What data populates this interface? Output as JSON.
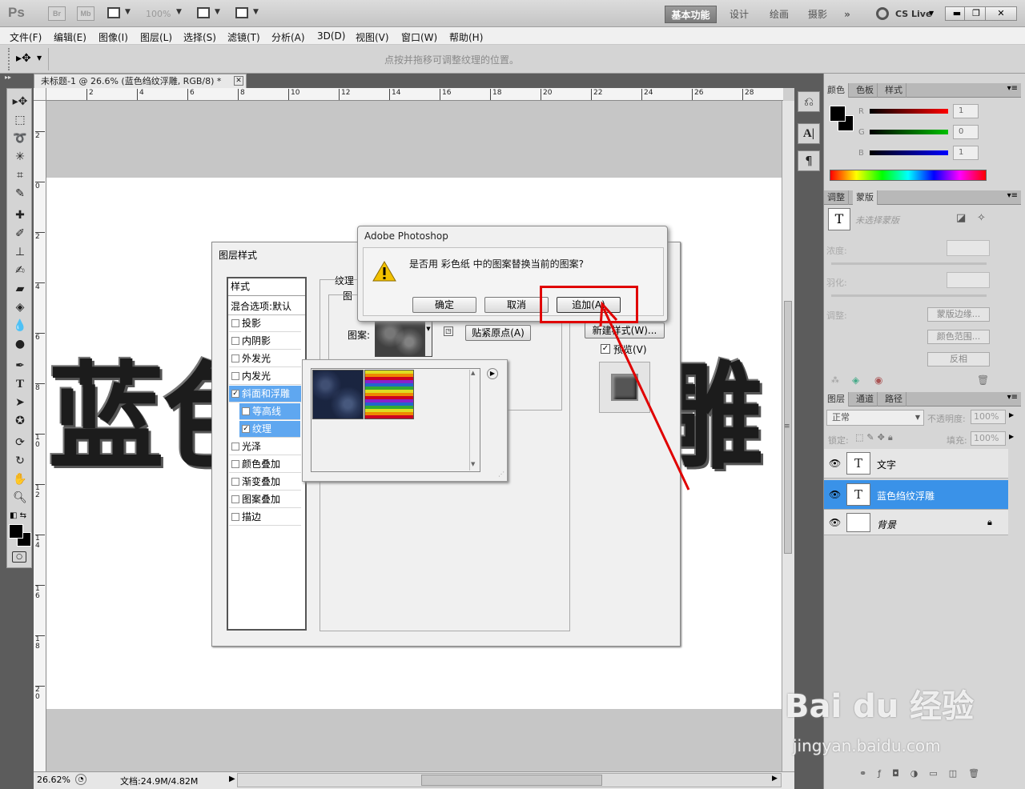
{
  "titlebar": {
    "app_logo": "Ps",
    "br": "Br",
    "mb": "Mb",
    "zoom": "100%",
    "workspaces": [
      "基本功能",
      "设计",
      "绘画",
      "摄影"
    ],
    "more_workspaces": "»",
    "cs_live": "CS Live",
    "window_controls": [
      "minimize-icon",
      "restore-icon",
      "close-icon"
    ]
  },
  "menubar": {
    "items": [
      "文件(F)",
      "编辑(E)",
      "图像(I)",
      "图层(L)",
      "选择(S)",
      "滤镜(T)",
      "分析(A)",
      "3D(D)",
      "视图(V)",
      "窗口(W)",
      "帮助(H)"
    ]
  },
  "optionsbar": {
    "hint": "点按并拖移可调整纹理的位置。"
  },
  "document": {
    "tab_title": "未标题-1 @ 26.6% (蓝色绉纹浮雕, RGB/8) *",
    "ruler_h": [
      "2",
      "4",
      "6",
      "8",
      "10",
      "12",
      "14",
      "16",
      "18",
      "20",
      "22",
      "24",
      "26",
      "28"
    ],
    "ruler_v": [
      "2",
      "0",
      "2",
      "4",
      "6",
      "8",
      "1\n0",
      "1\n2",
      "1\n4",
      "1\n6",
      "1\n8",
      "2\n0"
    ],
    "canvas_text_left": "蓝色",
    "canvas_text_right": "雕"
  },
  "status": {
    "zoom": "26.62%",
    "doc_size": "文档:24.9M/4.82M"
  },
  "color_panel": {
    "tabs": [
      "颜色",
      "色板",
      "样式"
    ],
    "channels": [
      {
        "label": "R",
        "value": "1",
        "color": "#ff0000"
      },
      {
        "label": "G",
        "value": "0",
        "color": "#00c000"
      },
      {
        "label": "B",
        "value": "1",
        "color": "#0000ff"
      }
    ]
  },
  "masks_panel": {
    "tabs": [
      "调整",
      "蒙版"
    ],
    "no_selection": "未选择蒙版",
    "density_label": "浓度:",
    "feather_label": "羽化:",
    "adjust_label": "调整:",
    "buttons": [
      "蒙版边缘...",
      "颜色范围...",
      "反相"
    ]
  },
  "layers_panel": {
    "tabs": [
      "图层",
      "通道",
      "路径"
    ],
    "blend_mode": "正常",
    "opacity_label": "不透明度:",
    "opacity": "100%",
    "lock_label": "锁定:",
    "fill_label": "填充:",
    "fill": "100%",
    "layers": [
      {
        "name": "文字",
        "type": "T",
        "selected": false
      },
      {
        "name": "蓝色绉纹浮雕",
        "type": "T",
        "selected": true
      },
      {
        "name": "背景",
        "type": "",
        "selected": false
      }
    ]
  },
  "layer_style_dialog": {
    "title": "图层样式",
    "styles_header": "样式",
    "blend_options": "混合选项:默认",
    "styles": [
      {
        "label": "投影",
        "checked": false,
        "highlight": false,
        "indent": false
      },
      {
        "label": "内阴影",
        "checked": false,
        "highlight": false,
        "indent": false
      },
      {
        "label": "外发光",
        "checked": false,
        "highlight": false,
        "indent": false
      },
      {
        "label": "内发光",
        "checked": false,
        "highlight": false,
        "indent": false
      },
      {
        "label": "斜面和浮雕",
        "checked": true,
        "highlight": true,
        "indent": false
      },
      {
        "label": "等高线",
        "checked": false,
        "highlight": true,
        "indent": true
      },
      {
        "label": "纹理",
        "checked": true,
        "highlight": true,
        "indent": true
      },
      {
        "label": "光泽",
        "checked": false,
        "highlight": false,
        "indent": false
      },
      {
        "label": "颜色叠加",
        "checked": false,
        "highlight": false,
        "indent": false
      },
      {
        "label": "渐变叠加",
        "checked": false,
        "highlight": false,
        "indent": false
      },
      {
        "label": "图案叠加",
        "checked": false,
        "highlight": false,
        "indent": false
      },
      {
        "label": "描边",
        "checked": false,
        "highlight": false,
        "indent": false
      }
    ],
    "section_texture": "纹理",
    "section_pattern_partial": "图",
    "pattern_label": "图案:",
    "snap_origin": "贴紧原点(A)",
    "new_style": "新建样式(W)...",
    "preview_label": "预览(V)"
  },
  "alert_dialog": {
    "title": "Adobe Photoshop",
    "message": "是否用 彩色纸 中的图案替换当前的图案?",
    "buttons": [
      "确定",
      "取消",
      "追加(A)"
    ]
  },
  "watermark": {
    "logo": "Bai du 经验",
    "url": "jingyan.baidu.com"
  }
}
